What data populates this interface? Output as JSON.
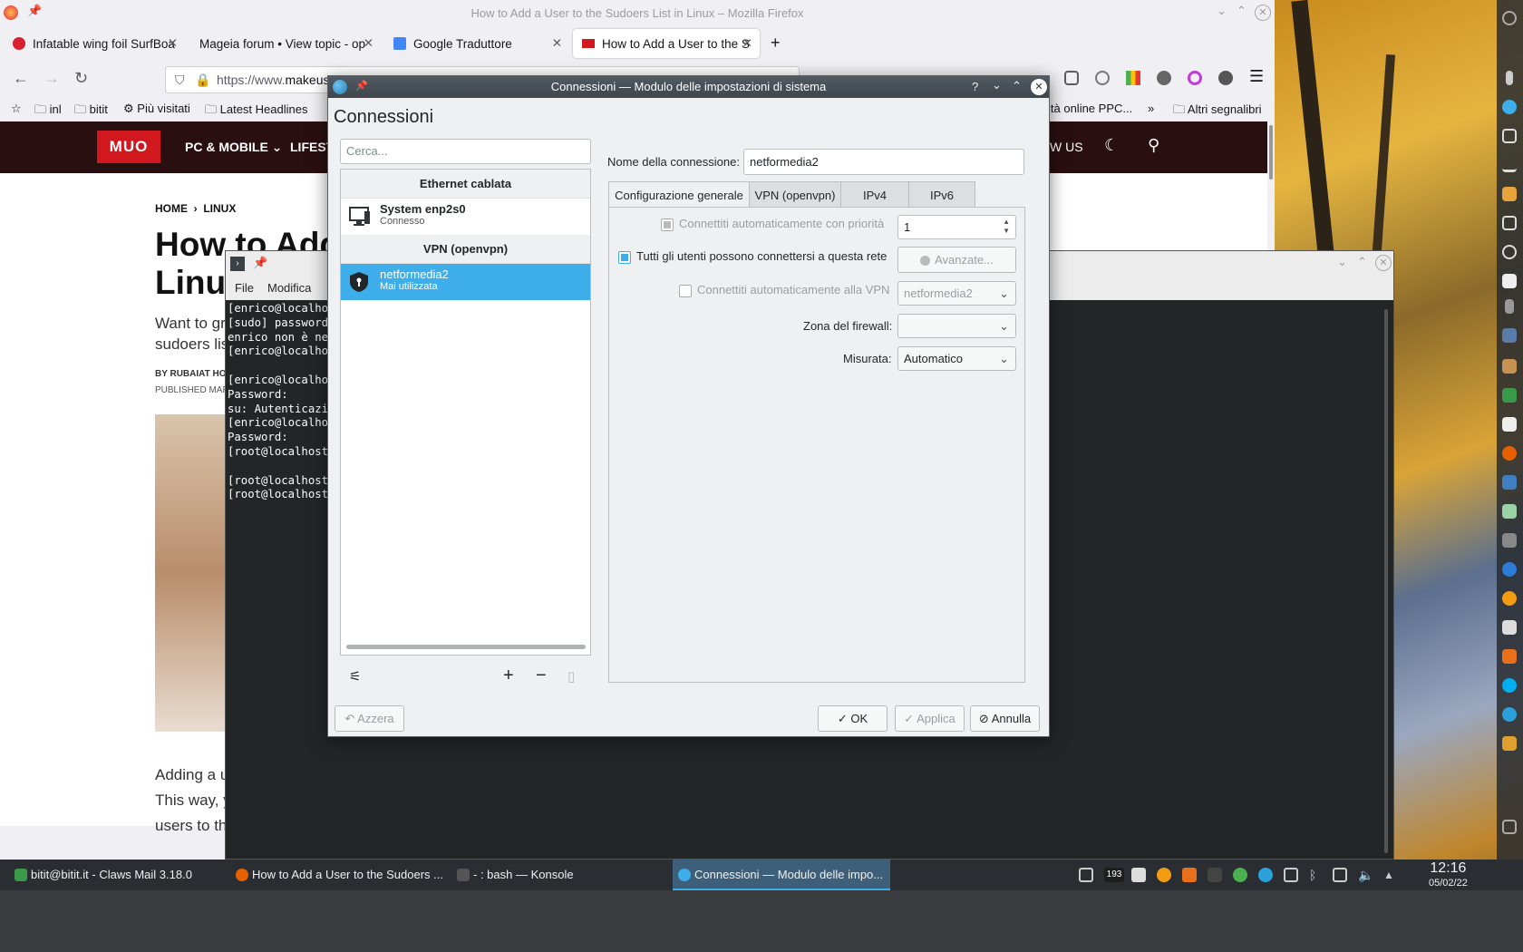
{
  "firefox": {
    "window_title": "How to Add a User to the Sudoers List in Linux – Mozilla Firefox",
    "tabs": [
      {
        "label": "Infatable wing foil SurfBoa"
      },
      {
        "label": "Mageia forum • View topic - op"
      },
      {
        "label": "Google Traduttore"
      },
      {
        "label": "How to Add a User to the S"
      }
    ],
    "url_prefix": "https://www.",
    "url_domain": "makeus",
    "bookmarks": [
      {
        "label": "inl"
      },
      {
        "label": "bitit"
      },
      {
        "label": "Più visitati"
      },
      {
        "label": "Latest Headlines"
      },
      {
        "label": "ità online PPC..."
      },
      {
        "label": "Altri segnalibri"
      }
    ]
  },
  "muo": {
    "logo": "MUO",
    "nav": [
      "PC & MOBILE",
      "LIFEST",
      "W US"
    ],
    "breadcrumb": [
      "HOME",
      "LINUX"
    ],
    "title_line1": "How to Add",
    "title_line2": "Linux",
    "sub_line1": "Want to gr",
    "sub_line2": "sudoers lis",
    "byline": "BY RUBAIAT HO",
    "published": "PUBLISHED MAR",
    "body_line1": "Adding a u",
    "body_line2": "This way, y",
    "body_line3": "users to th"
  },
  "konsole": {
    "menu": [
      "File",
      "Modifica"
    ],
    "lines": "[enrico@localho\n[sudo] password\nenrico non è ne\n[enrico@localho\n\n[enrico@localho\nPassword:\nsu: Autenticazi\n[enrico@localho\nPassword:\n[root@localhost\n\n[root@localhost\n[root@localhost"
  },
  "dialog": {
    "title": "Connessioni — Modulo delle impostazioni di sistema",
    "heading": "Connessioni",
    "search_placeholder": "Cerca...",
    "groups": [
      {
        "name": "Ethernet cablata",
        "items": [
          {
            "name": "System enp2s0",
            "status": "Connesso"
          }
        ]
      },
      {
        "name": "VPN (openvpn)",
        "items": [
          {
            "name": "netformedia2",
            "status": "Mai utilizzata"
          }
        ]
      }
    ],
    "conn_name_label": "Nome della connessione:",
    "conn_name_value": "netformedia2",
    "tabs": [
      "Configurazione generale",
      "VPN (openvpn)",
      "IPv4",
      "IPv6"
    ],
    "auto_priority_label": "Connettiti automaticamente con priorità",
    "auto_priority_value": "1",
    "all_users_label": "Tutti gli utenti possono connettersi a questa rete",
    "advanced_label": "Avanzate...",
    "auto_vpn_label": "Connettiti automaticamente alla VPN",
    "auto_vpn_value": "netformedia2",
    "firewall_label": "Zona del firewall:",
    "firewall_value": "",
    "metered_label": "Misurata:",
    "metered_value": "Automatico",
    "reset_label": "Azzera",
    "ok_label": "OK",
    "apply_label": "Applica",
    "cancel_label": "Annulla"
  },
  "taskbar": {
    "tasks": [
      {
        "label": "bitit@bitit.it - Claws Mail 3.18.0"
      },
      {
        "label": "How to Add a User to the Sudoers ..."
      },
      {
        "label": "- : bash — Konsole"
      },
      {
        "label": "Connessioni — Modulo delle impo..."
      }
    ],
    "tray_badge": "193",
    "time": "12:16",
    "date": "05/02/22"
  },
  "colors": {
    "accent": "#3daee9",
    "muo_red": "#d0181e",
    "muo_header": "#2a0f10"
  }
}
